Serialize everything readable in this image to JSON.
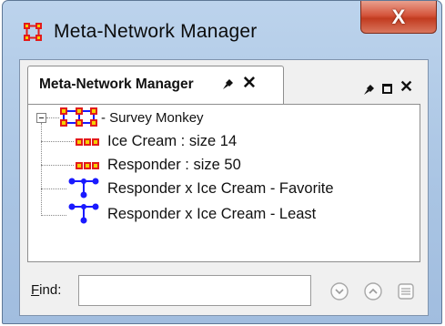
{
  "window": {
    "title": "Meta-Network Manager",
    "close_glyph": "X",
    "icon": "meta-network-icon"
  },
  "tab": {
    "label": "Meta-Network Manager",
    "pin_icon": "pin-icon",
    "close_glyph": "✕"
  },
  "panel_controls": {
    "pin_icon": "pin-icon",
    "maximize_icon": "maximize-icon",
    "close_glyph": "✕"
  },
  "tree": {
    "root": {
      "label": "- Survey Monkey",
      "expanded": true,
      "icon": "meta-network-icon"
    },
    "nodes": [
      {
        "label": "Ice Cream : size 14",
        "icon": "nodeset-icon"
      },
      {
        "label": "Responder : size 50",
        "icon": "nodeset-icon"
      },
      {
        "label": "Responder x Ice Cream - Favorite",
        "icon": "network-icon"
      },
      {
        "label": "Responder x Ice Cream - Least",
        "icon": "network-icon"
      }
    ]
  },
  "find": {
    "label_first": "F",
    "label_rest": "ind:",
    "value": "",
    "buttons": [
      "find-next-icon",
      "find-previous-icon",
      "find-list-icon"
    ]
  },
  "colors": {
    "nodeset": "#e31b1b",
    "nodeset_fill": "#f5d000",
    "network": "#1a1aff",
    "close_button": "#c7432a"
  }
}
